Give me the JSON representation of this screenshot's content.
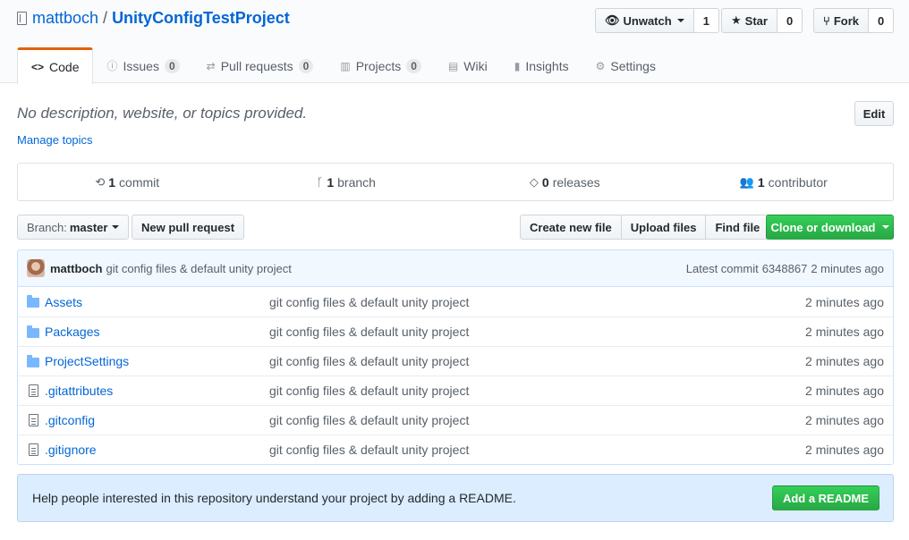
{
  "repo": {
    "owner": "mattboch",
    "separator": "/",
    "name": "UnityConfigTestProject"
  },
  "social": {
    "watch": {
      "label": "Unwatch",
      "count": "1"
    },
    "star": {
      "label": "Star",
      "count": "0"
    },
    "fork": {
      "label": "Fork",
      "count": "0"
    }
  },
  "tabs": [
    {
      "label": "Code",
      "icon": "code-icon"
    },
    {
      "label": "Issues",
      "count": "0",
      "icon": "issue-icon"
    },
    {
      "label": "Pull requests",
      "count": "0",
      "icon": "pull-request-icon"
    },
    {
      "label": "Projects",
      "count": "0",
      "icon": "project-icon"
    },
    {
      "label": "Wiki",
      "icon": "book-icon"
    },
    {
      "label": "Insights",
      "icon": "graph-icon"
    },
    {
      "label": "Settings",
      "icon": "gear-icon"
    }
  ],
  "about": {
    "description": "No description, website, or topics provided.",
    "manage_topics": "Manage topics",
    "edit_label": "Edit"
  },
  "summary": {
    "commits": {
      "count": "1",
      "label": "commit"
    },
    "branches": {
      "count": "1",
      "label": "branch"
    },
    "releases": {
      "count": "0",
      "label": "releases"
    },
    "contributors": {
      "count": "1",
      "label": "contributor"
    }
  },
  "toolbar": {
    "branch_prefix": "Branch:",
    "branch_name": "master",
    "new_pr": "New pull request",
    "create_file": "Create new file",
    "upload_files": "Upload files",
    "find_file": "Find file",
    "clone": "Clone or download"
  },
  "latest_commit": {
    "author": "mattboch",
    "message": "git config files & default unity project",
    "prefix": "Latest commit",
    "sha": "6348867",
    "age": "2 minutes ago"
  },
  "files": [
    {
      "name": "Assets",
      "type": "folder",
      "message": "git config files & default unity project",
      "age": "2 minutes ago"
    },
    {
      "name": "Packages",
      "type": "folder",
      "message": "git config files & default unity project",
      "age": "2 minutes ago"
    },
    {
      "name": "ProjectSettings",
      "type": "folder",
      "message": "git config files & default unity project",
      "age": "2 minutes ago"
    },
    {
      "name": ".gitattributes",
      "type": "file",
      "message": "git config files & default unity project",
      "age": "2 minutes ago"
    },
    {
      "name": ".gitconfig",
      "type": "file",
      "message": "git config files & default unity project",
      "age": "2 minutes ago"
    },
    {
      "name": ".gitignore",
      "type": "file",
      "message": "git config files & default unity project",
      "age": "2 minutes ago"
    }
  ],
  "readme_prompt": {
    "text": "Help people interested in this repository understand your project by adding a README.",
    "button": "Add a README"
  },
  "colors": {
    "link": "#0366d6",
    "accent_tab": "#e36209",
    "primary_button": "#28a745",
    "folder": "#79b8ff"
  }
}
